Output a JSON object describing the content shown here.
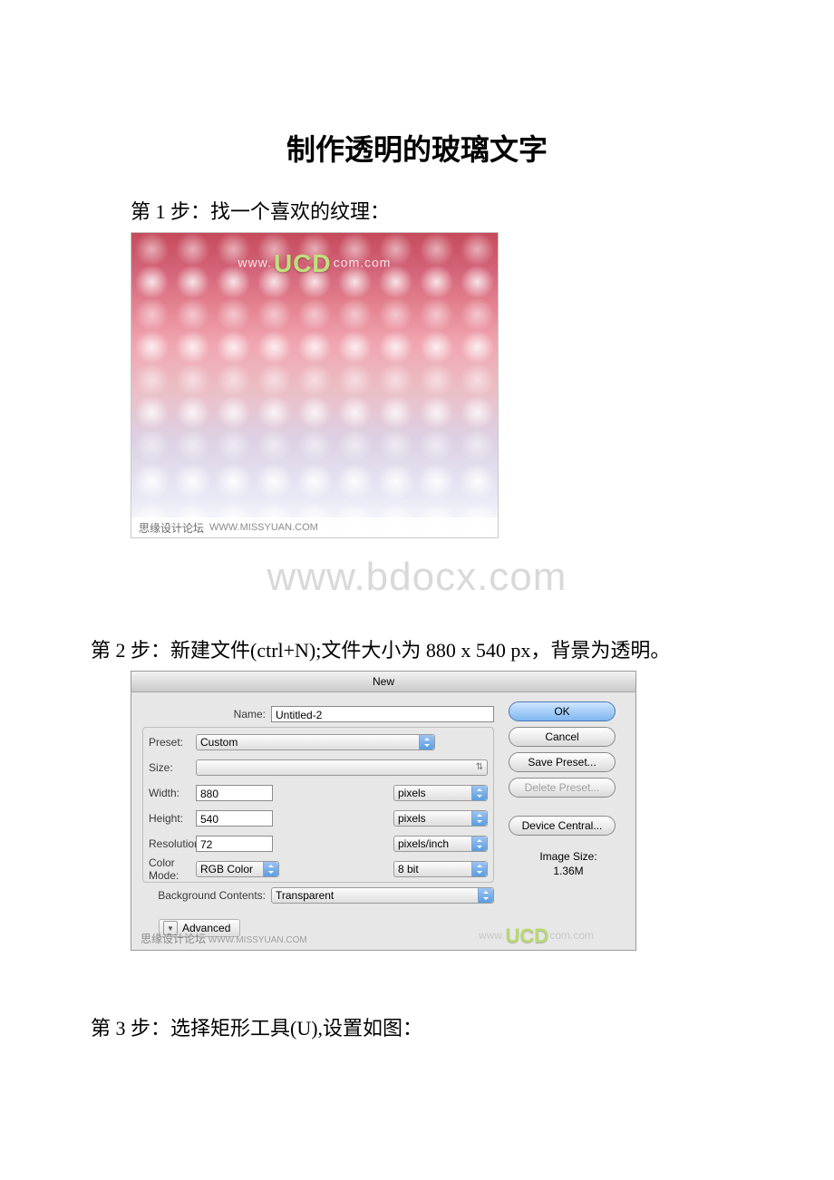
{
  "title": "制作透明的玻璃文字",
  "step1": "第 1 步：找一个喜欢的纹理：",
  "step2": "第 2 步：新建文件(ctrl+N);文件大小为 880 x 540 px，背景为透明。",
  "step3": "第 3 步：选择矩形工具(U),设置如图：",
  "watermark": "www.bdocx.com",
  "texture": {
    "wm_url_prefix": "www.",
    "wm_brand": "UCD",
    "wm_url_suffix": "com.com",
    "footer_cn": "思缘设计论坛",
    "footer_url": "WWW.MISSYUAN.COM"
  },
  "dialog": {
    "title": "New",
    "name_label": "Name:",
    "name_value": "Untitled-2",
    "preset_label": "Preset:",
    "preset_value": "Custom",
    "size_label": "Size:",
    "size_value": "",
    "width_label": "Width:",
    "width_value": "880",
    "height_label": "Height:",
    "height_value": "540",
    "resolution_label": "Resolution:",
    "resolution_value": "72",
    "pixels": "pixels",
    "ppi": "pixels/inch",
    "color_mode_label": "Color Mode:",
    "color_mode_value": "RGB Color",
    "color_depth": "8 bit",
    "bg_label": "Background Contents:",
    "bg_value": "Transparent",
    "advanced": "Advanced",
    "image_size_label": "Image Size:",
    "image_size_value": "1.36M",
    "ok": "OK",
    "cancel": "Cancel",
    "save_preset": "Save Preset...",
    "delete_preset": "Delete Preset...",
    "device_central": "Device Central...",
    "footer_cn": "思缘设计论坛",
    "footer_url": "WWW.MISSYUAN.COM",
    "wm_url_prefix": "www.",
    "wm_brand": "UCD",
    "wm_url_suffix": "com.com"
  }
}
